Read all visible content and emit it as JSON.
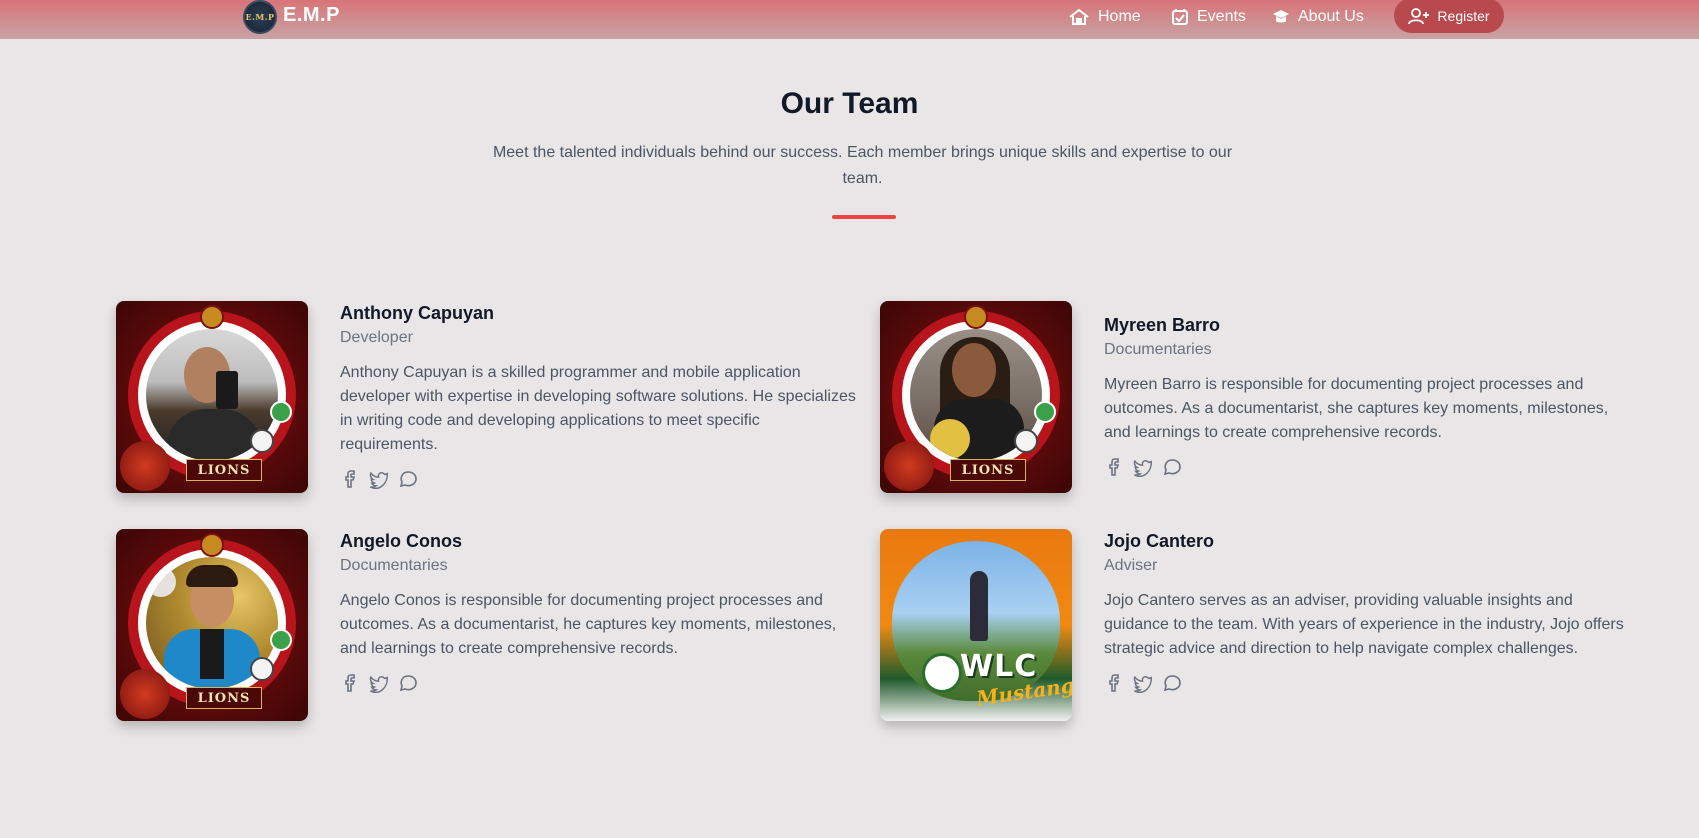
{
  "nav": {
    "logo_text": "E.M.P",
    "brand": "E.M.P",
    "items": [
      {
        "label": "Home",
        "icon": "home-icon"
      },
      {
        "label": "Events",
        "icon": "calendar-check-icon"
      },
      {
        "label": "About Us",
        "icon": "graduation-cap-icon"
      }
    ],
    "register_label": "Register"
  },
  "header": {
    "title": "Our Team",
    "subtitle": "Meet the talented individuals behind our success. Each member brings unique skills and expertise to our team.",
    "divider_color": "#ef4444"
  },
  "members": [
    {
      "name": "Anthony Capuyan",
      "role": "Developer",
      "description": "Anthony Capuyan is a skilled programmer and mobile application developer with expertise in developing software solutions. He specializes in writing code and developing applications to meet specific requirements.",
      "frame": "lions-frame",
      "badge": "LIONS"
    },
    {
      "name": "Myreen Barro",
      "role": "Documentaries",
      "description": "Myreen Barro is responsible for documenting project processes and outcomes. As a documentarist, she captures key moments, milestones, and learnings to create comprehensive records.",
      "frame": "lions-frame",
      "badge": "LIONS"
    },
    {
      "name": "Angelo Conos",
      "role": "Documentaries",
      "description": "Angelo Conos is responsible for documenting project processes and outcomes. As a documentarist, he captures key moments, milestones, and learnings to create comprehensive records.",
      "frame": "lions-frame",
      "badge": "LIONS"
    },
    {
      "name": "Jojo Cantero",
      "role": "Adviser",
      "description": "Jojo Cantero serves as an adviser, providing valuable insights and guidance to the team. With years of experience in the industry, Jojo offers strategic advice and direction to help navigate complex challenges.",
      "frame": "mustangs-frame",
      "badge": "WLC",
      "badge_script": "Mustangs"
    }
  ],
  "social_icons": [
    "facebook-icon",
    "twitter-icon",
    "message-circle-icon"
  ],
  "colors": {
    "navbar": "#d87478",
    "register_button": "#b84a4e",
    "accent": "#ef4444",
    "background": "#e9e6e7"
  }
}
